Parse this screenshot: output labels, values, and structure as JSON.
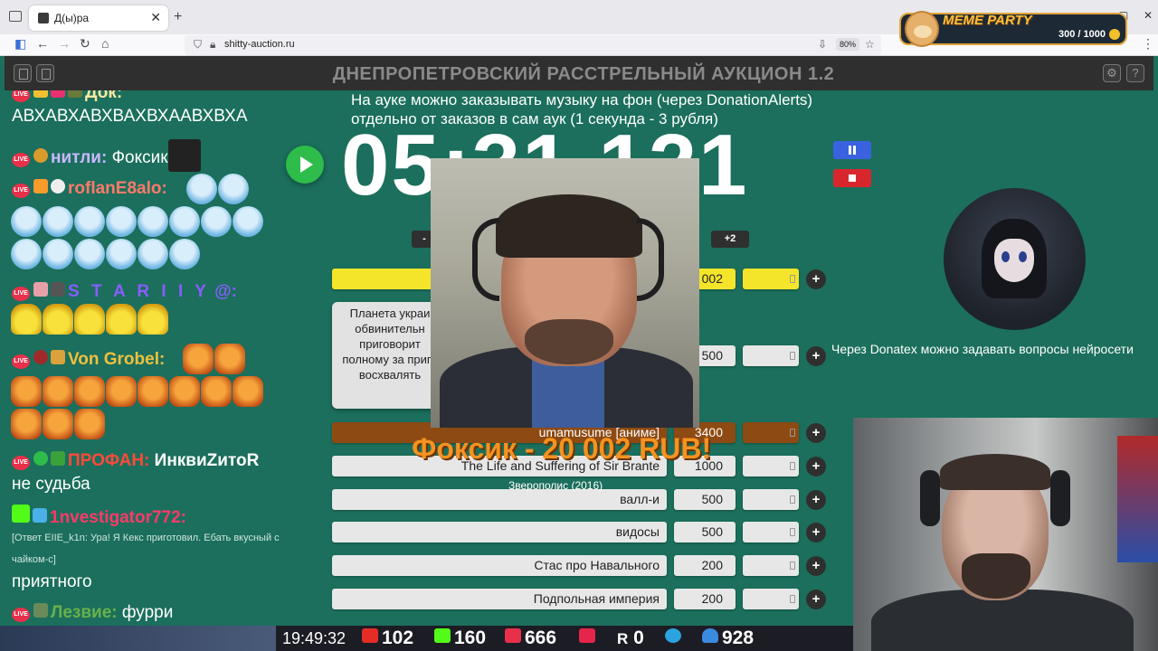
{
  "browser": {
    "tab_title": "Д(ы)ра",
    "tab_close": "✕",
    "new_tab": "+",
    "url": "shitty-auction.ru",
    "zoom": "80%",
    "nav": {
      "back": "←",
      "forward": "→",
      "reload": "↻",
      "home": "⌂"
    }
  },
  "meme_party": {
    "title": "MEME PARTY",
    "count": "300 / 1000"
  },
  "app": {
    "title": "ДНЕПРОПЕТРОВСКИЙ РАССТРЕЛЬНЫЙ АУКЦИОН 1.2",
    "notice_line1": "На ауке можно заказывать музыку на фон (через DonationAlerts)",
    "notice_line2": "отдельно от заказов в сам аук (1 секунда - 3 рубля)",
    "timer": "05:31.121",
    "minus_label": "-",
    "plus2_label": "+2",
    "donatex_text": "Через Donatex можно задавать вопросы нейросети"
  },
  "chat": {
    "messages": [
      {
        "nick": "Док:",
        "text": ""
      },
      {
        "nick": "",
        "text": "АВХАВХАВХВАХВХААВХВХА"
      },
      {
        "nick": "нитли:",
        "text": "Фоксик"
      },
      {
        "nick": "roflanE8alo:",
        "text": ""
      },
      {
        "nick": "S T A R I I Y",
        "text": "@:"
      },
      {
        "nick": "Von Grobel:",
        "text": ""
      },
      {
        "nick": "ПРОФАН:",
        "text": "ИнквиZитоR"
      },
      {
        "nick": "",
        "text": "не судьба"
      },
      {
        "nick": "1nvestigator772:",
        "text": ""
      },
      {
        "nick": "",
        "text": "[Ответ EIIE_k1n: Ура! Я Кекс приготовил. Ебать вкусный с чайком-с]"
      },
      {
        "nick": "",
        "text": "приятного"
      },
      {
        "nick": "Лезвие:",
        "text": "фурри"
      }
    ]
  },
  "lots": [
    {
      "name": "",
      "amount": "20 002",
      "style": "yellow"
    },
    {
      "name": "Планета украи обвинительн приговорит полному за приго восхвалять",
      "amount": "500",
      "style": "card"
    },
    {
      "name": "umamusume [аниме]",
      "amount": "3400",
      "style": "brown"
    },
    {
      "name": "The Life and Suffering of Sir Brante",
      "amount": "1000",
      "style": "normal"
    },
    {
      "name": "валл-и",
      "amount": "500",
      "style": "normal"
    },
    {
      "name": "видосы",
      "amount": "500",
      "style": "normal"
    },
    {
      "name": "Стас про Навального",
      "amount": "200",
      "style": "normal"
    },
    {
      "name": "Подпольная империя",
      "amount": "200",
      "style": "normal"
    }
  ],
  "overlay": {
    "donation": "Фоксик - 20 002 RUB!",
    "subtitle": "Зверополис (2016)"
  },
  "stats": {
    "time": "19:49:32",
    "youtube": "102",
    "kick": "160",
    "vk": "666",
    "rutube": "0",
    "r": "0",
    "viewers": "928"
  },
  "colors": {
    "background": "#1b6f5c",
    "accent_yellow": "#f4e52a",
    "accent_brown": "#8d4a12",
    "donation_orange": "#f59221",
    "play_green": "#2ebc4a",
    "pause_blue": "#3a62e0",
    "stop_red": "#d8272c"
  }
}
